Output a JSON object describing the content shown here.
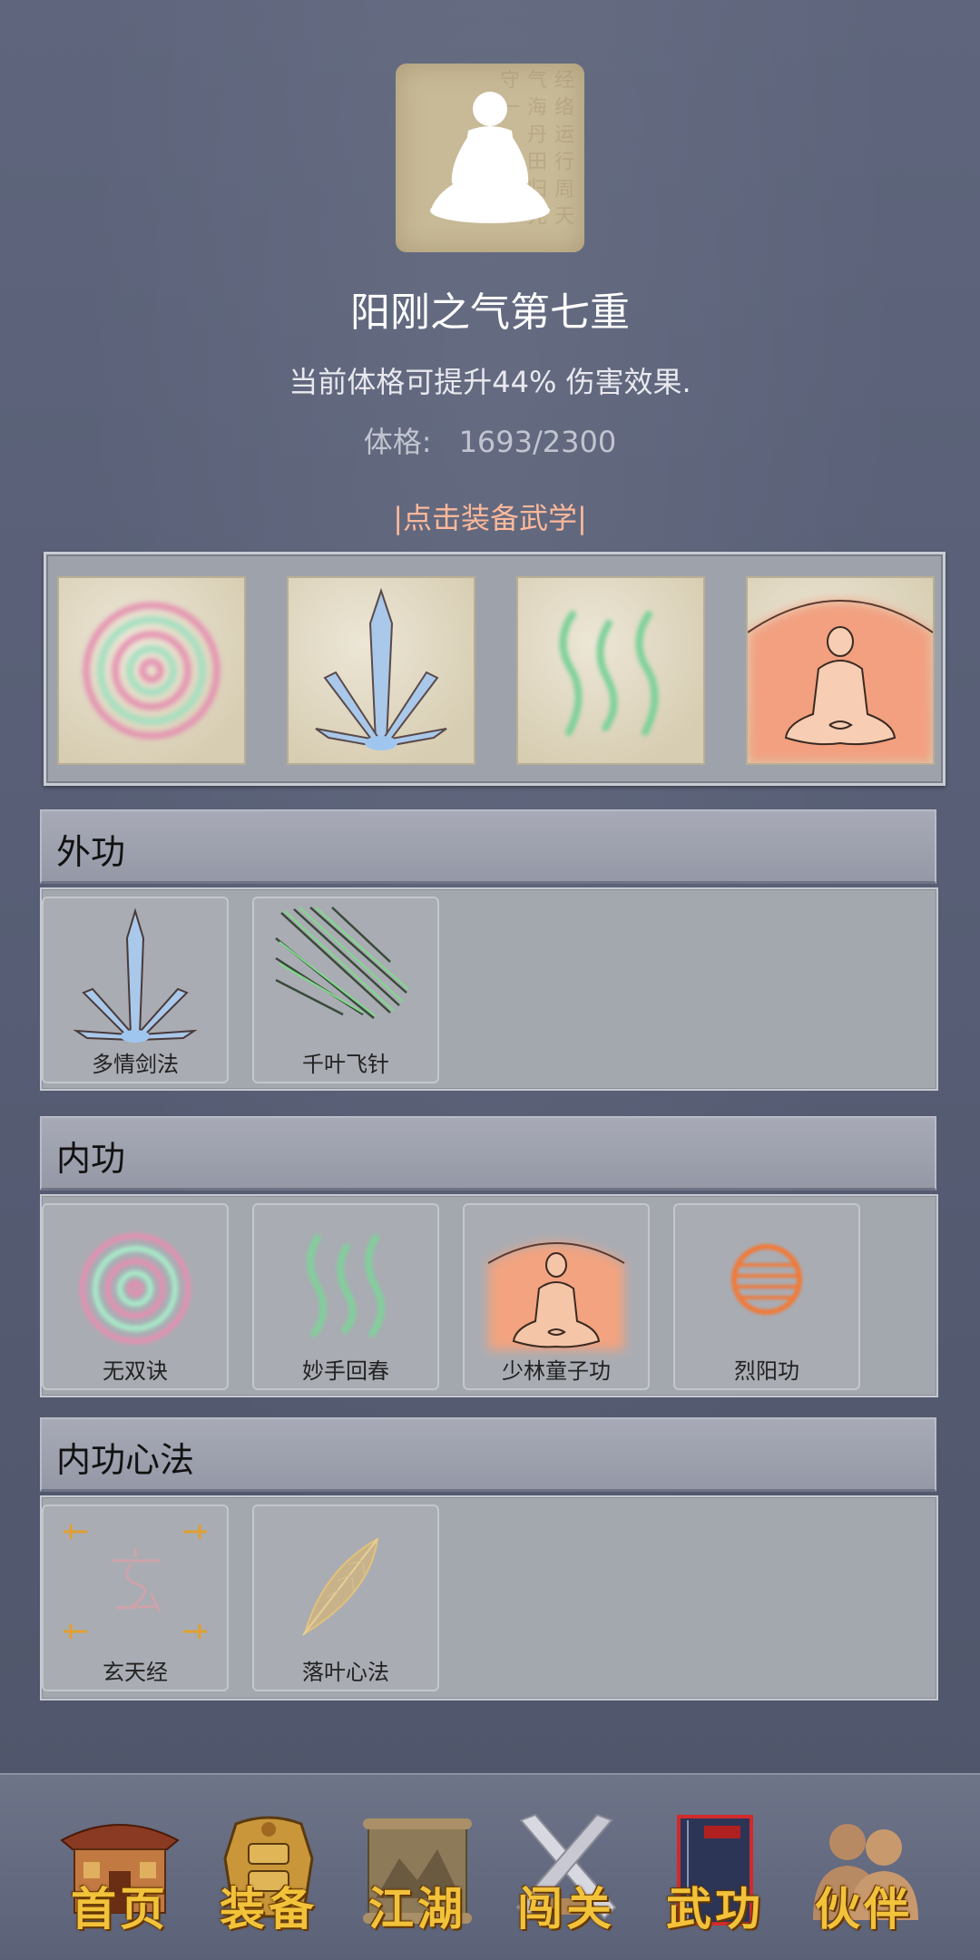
{
  "header": {
    "title": "阳刚之气第七重",
    "description": "当前体格可提升44% 伤害效果.",
    "stat_label": "体格:",
    "stat_value": "1693/2300",
    "equip_link": "|点击装备武学|"
  },
  "equipped_slots": [
    {
      "icon": "spiral-icon"
    },
    {
      "icon": "sword-fan-icon"
    },
    {
      "icon": "wavy-lines-icon"
    },
    {
      "icon": "meditating-monk-icon"
    }
  ],
  "sections": {
    "waigong": {
      "title": "外功",
      "skills": [
        {
          "label": "多情剑法",
          "icon": "sword-fan-icon"
        },
        {
          "label": "千叶飞针",
          "icon": "needles-icon"
        }
      ]
    },
    "neigong": {
      "title": "内功",
      "skills": [
        {
          "label": "无双诀",
          "icon": "spiral-icon"
        },
        {
          "label": "妙手回春",
          "icon": "wavy-lines-icon"
        },
        {
          "label": "少林童子功",
          "icon": "meditating-monk-icon"
        },
        {
          "label": "烈阳功",
          "icon": "sun-ball-icon"
        }
      ]
    },
    "xinfa": {
      "title": "内功心法",
      "skills": [
        {
          "label": "玄天经",
          "icon": "xuan-character-icon"
        },
        {
          "label": "落叶心法",
          "icon": "leaf-icon"
        }
      ]
    }
  },
  "navbar": {
    "items": [
      {
        "label": "首页",
        "icon": "house-icon"
      },
      {
        "label": "装备",
        "icon": "armor-icon"
      },
      {
        "label": "江湖",
        "icon": "scroll-map-icon"
      },
      {
        "label": "闯关",
        "icon": "crossed-swords-icon"
      },
      {
        "label": "武功",
        "icon": "book-icon"
      },
      {
        "label": "伙伴",
        "icon": "companions-icon"
      }
    ]
  },
  "colors": {
    "background": "#5a6178",
    "equip_link": "#ffb89a",
    "nav_label": "#f2c23a",
    "panel": "#a3a7ae"
  }
}
